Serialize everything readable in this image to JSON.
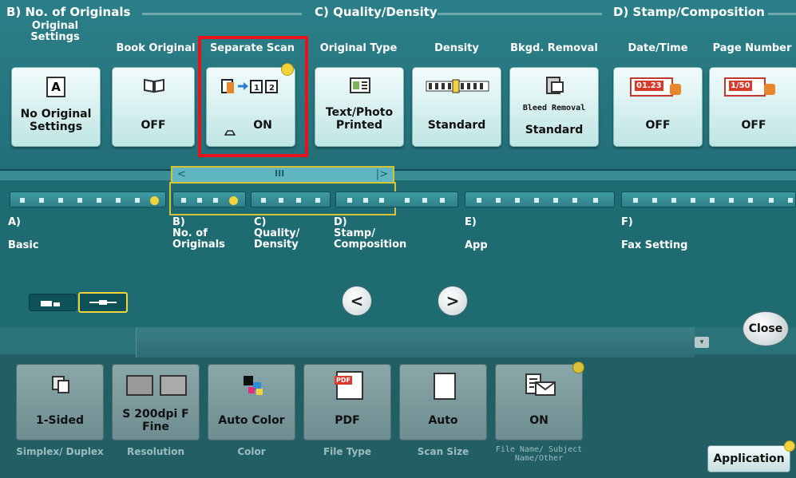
{
  "sections": {
    "b": {
      "title": "B)   No. of Originals"
    },
    "c": {
      "title": "C)   Quality/Density"
    },
    "d": {
      "title": "D)   Stamp/Composition"
    }
  },
  "tiles": [
    {
      "label": "Original Settings",
      "value": "No Original Settings",
      "icon": "letter-a-icon"
    },
    {
      "label": "Book Original",
      "value": "OFF",
      "icon": "open-book-icon"
    },
    {
      "label": "Separate Scan",
      "value": "ON",
      "icon": "separate-scan-icon",
      "highlighted": true
    },
    {
      "label": "Original Type",
      "value": "Text/Photo Printed",
      "icon": "text-photo-icon"
    },
    {
      "label": "Density",
      "value": "Standard",
      "icon": "density-scale-icon"
    },
    {
      "label": "Bkgd. Removal",
      "value": "Standard",
      "small_text": "Bleed Removal",
      "icon": "background-removal-icon"
    },
    {
      "label": "Date/Time",
      "value": "OFF",
      "icon_text": "01.23",
      "icon": "date-stamp-icon"
    },
    {
      "label": "Page Number",
      "value": "OFF",
      "icon_text": "1/50",
      "icon": "page-number-icon"
    }
  ],
  "navigator": {
    "scroll_grip": "III",
    "scroll_left": "<",
    "scroll_right": "|>",
    "items": [
      {
        "letter": "A)",
        "name": "Basic"
      },
      {
        "letter": "B)",
        "name": "No. of Originals"
      },
      {
        "letter": "C)",
        "name": "Quality/ Density"
      },
      {
        "letter": "D)",
        "name": "Stamp/ Composition"
      },
      {
        "letter": "E)",
        "name": "App"
      },
      {
        "letter": "F)",
        "name": "Fax Setting"
      }
    ],
    "prev": "<",
    "next": ">"
  },
  "close_label": "Close",
  "bottom_tiles": [
    {
      "value": "1-Sided",
      "label": "Simplex/ Duplex",
      "icon": "one-sided-icon"
    },
    {
      "value": "S 200dpi F Fine",
      "label": "Resolution",
      "icon": "resolution-icon"
    },
    {
      "value": "Auto Color",
      "label": "Color",
      "icon": "color-squares-icon"
    },
    {
      "value": "PDF",
      "label": "File Type",
      "icon_text": "PDF",
      "icon": "pdf-file-icon"
    },
    {
      "value": "Auto",
      "label": "Scan Size",
      "icon": "page-icon"
    },
    {
      "value": "ON",
      "label": "File Name/ Subject Name/Other",
      "icon": "envelope-list-icon"
    }
  ],
  "application_label": "Application",
  "colors": {
    "highlight_red": "#e8131a",
    "indicator_yellow": "#f2d23a",
    "teal": "#2b7f88"
  }
}
